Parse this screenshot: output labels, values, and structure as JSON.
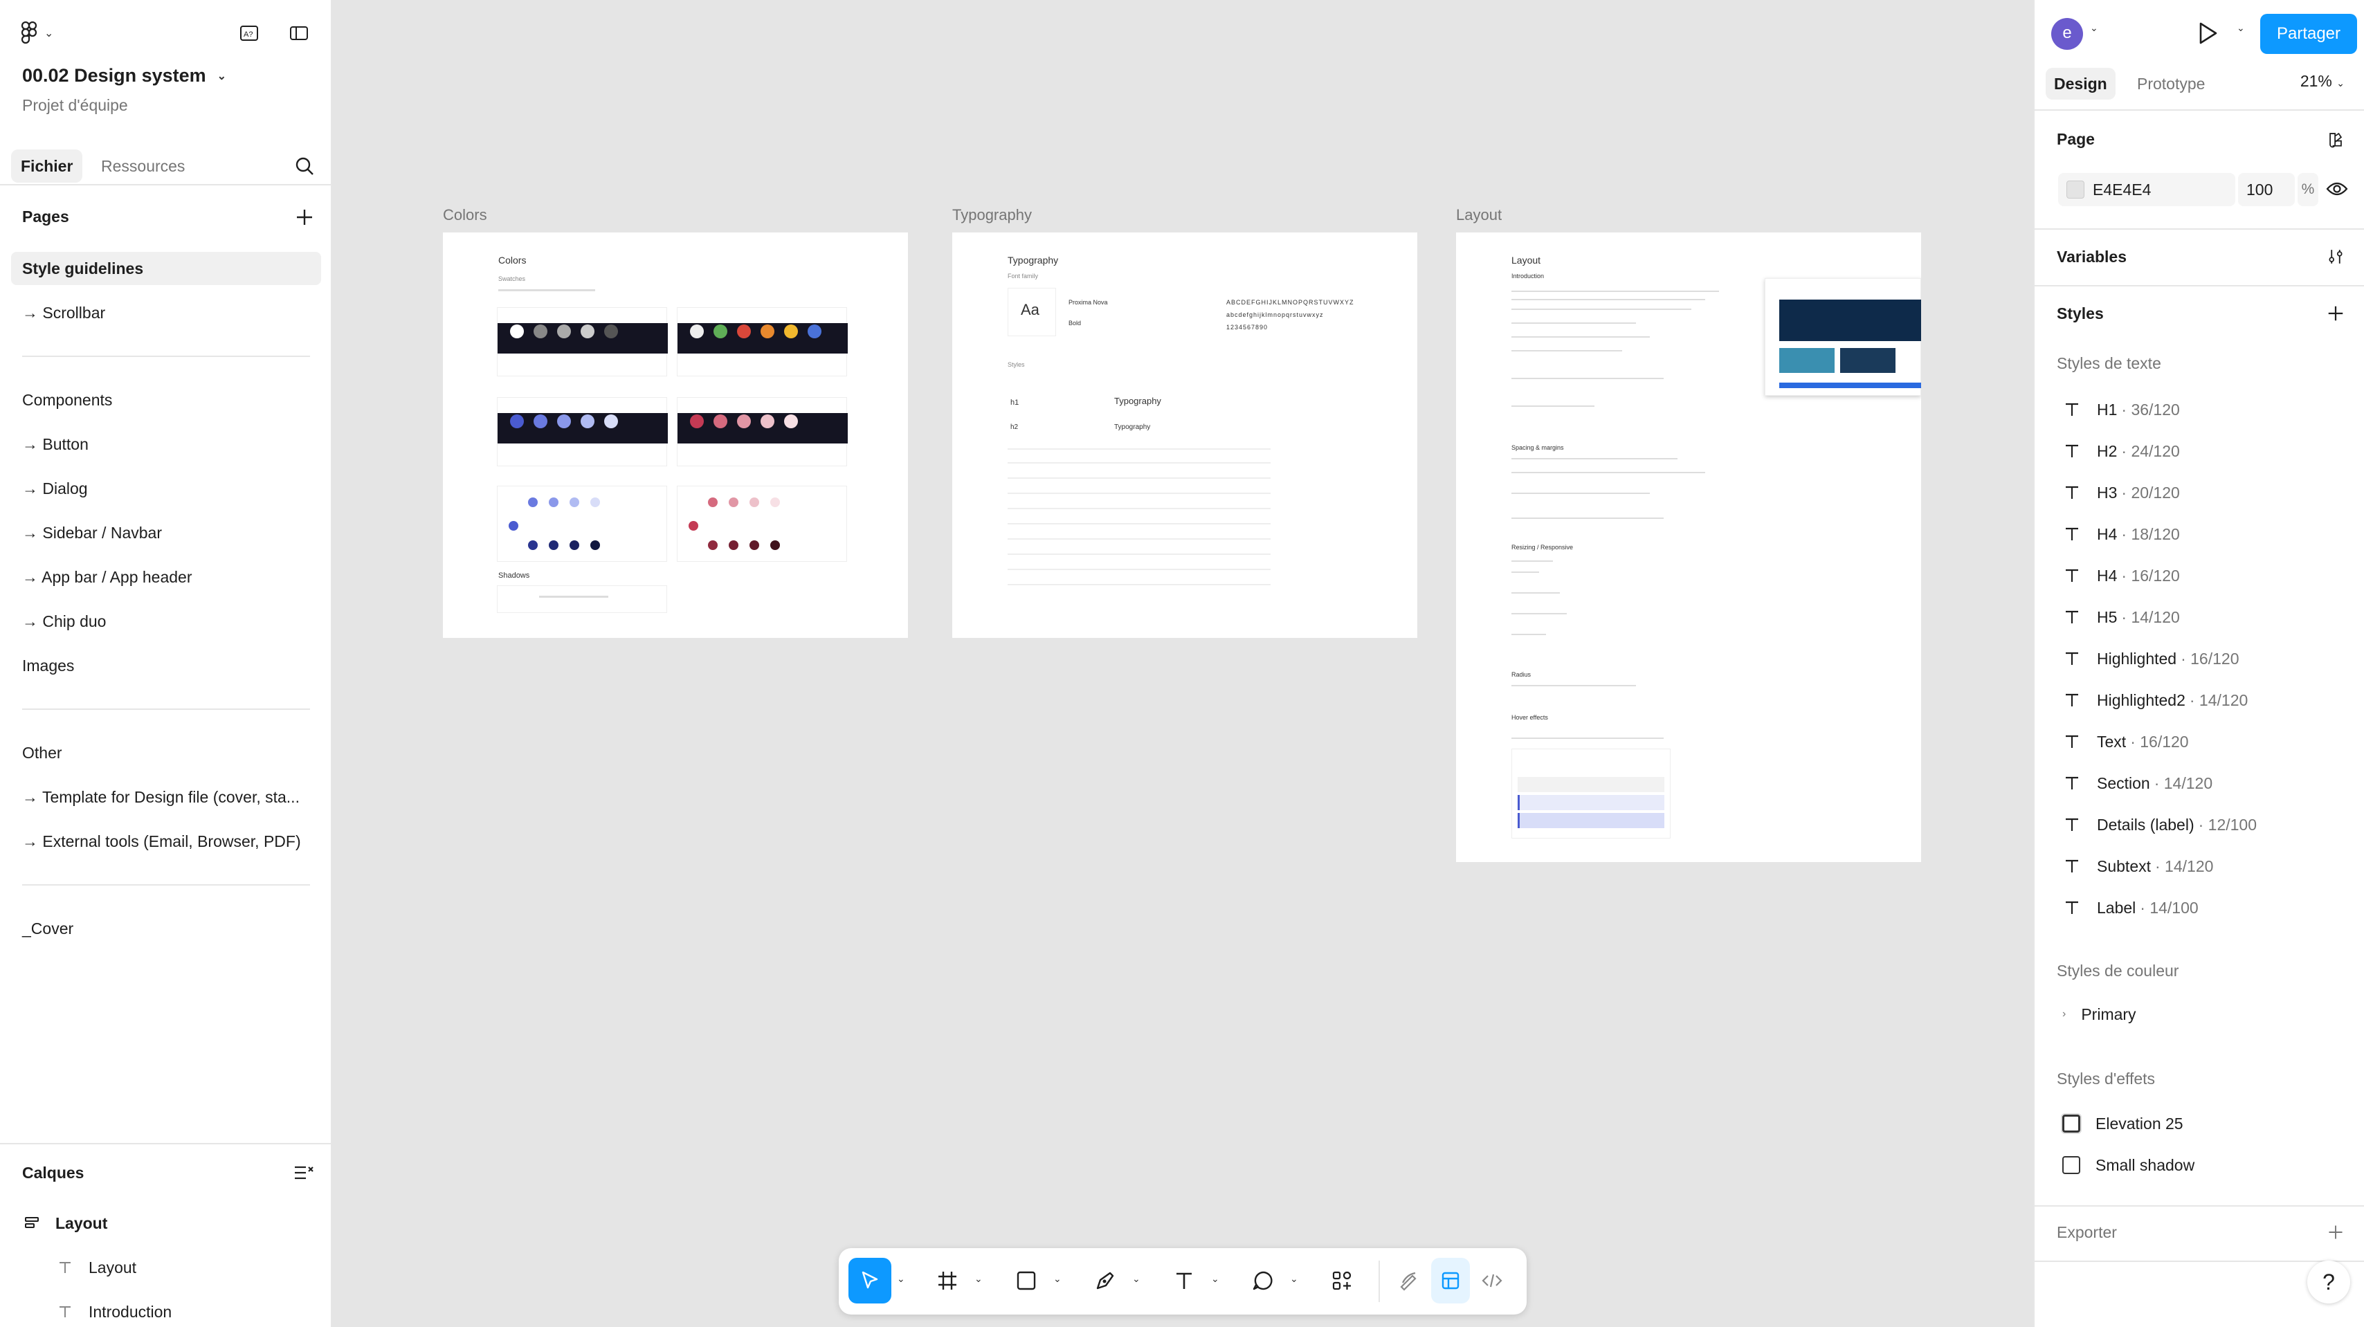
{
  "file": {
    "title": "00.02 Design system",
    "team": "Projet d'équipe"
  },
  "left_tabs": {
    "file": "Fichier",
    "assets": "Ressources"
  },
  "pages": {
    "heading": "Pages",
    "groups": [
      {
        "items": [
          "Style guidelines",
          "→ Scrollbar"
        ]
      },
      {
        "items": [
          "Components",
          "→ Button",
          "→ Dialog",
          "→ Sidebar / Navbar",
          "→ App bar / App header",
          "→ Chip duo",
          "Images"
        ]
      },
      {
        "items": [
          "Other",
          "→ Template for Design file (cover, sta...",
          "→ External tools (Email, Browser, PDF)"
        ]
      },
      {
        "items": [
          "_Cover"
        ]
      }
    ]
  },
  "layers": {
    "heading": "Calques",
    "items": [
      "Layout",
      "Layout",
      "Introduction"
    ]
  },
  "canvas": {
    "frames": [
      {
        "label": "Colors",
        "title": "Colors",
        "subtitle": "Swatches",
        "section2": "Shadows"
      },
      {
        "label": "Typography",
        "title": "Typography",
        "subtitle": "Font family",
        "aa": "Aa",
        "font_name": "Proxima Nova",
        "weight": "Bold",
        "alphabet_upper": "ABCDEFGHIJKLMNOPQRSTUVWXYZ",
        "alphabet_lower": "abcdefghijklmnopqrstuvwxyz",
        "digits": "1234567890",
        "styles_label": "Styles",
        "h1": "h1",
        "h2": "h2",
        "sample": "Typography"
      },
      {
        "label": "Layout",
        "title": "Layout",
        "subtitle": "Introduction",
        "sec_spacing": "Spacing & margins",
        "sec_resize": "Resizing / Responsive",
        "sec_radius": "Radius",
        "sec_hover": "Hover effects"
      }
    ]
  },
  "right": {
    "avatar_letter": "e",
    "share": "Partager",
    "tabs": {
      "design": "Design",
      "prototype": "Prototype"
    },
    "zoom": "21%",
    "page": {
      "title": "Page",
      "color": "E4E4E4",
      "opacity": "100",
      "unit": "%"
    },
    "variables": "Variables",
    "styles": {
      "title": "Styles",
      "text_heading": "Styles de texte",
      "text_styles": [
        {
          "name": "H1",
          "meta": "· 36/120"
        },
        {
          "name": "H2",
          "meta": "· 24/120"
        },
        {
          "name": "H3",
          "meta": "· 20/120"
        },
        {
          "name": "H4",
          "meta": "· 18/120"
        },
        {
          "name": "H4",
          "meta": "· 16/120"
        },
        {
          "name": "H5",
          "meta": "· 14/120"
        },
        {
          "name": "Highlighted",
          "meta": "· 16/120"
        },
        {
          "name": "Highlighted2",
          "meta": "· 14/120"
        },
        {
          "name": "Text",
          "meta": "· 16/120"
        },
        {
          "name": "Section",
          "meta": "· 14/120"
        },
        {
          "name": "Details (label)",
          "meta": "· 12/100"
        },
        {
          "name": "Subtext",
          "meta": "· 14/120"
        },
        {
          "name": "Label",
          "meta": "· 14/100"
        }
      ],
      "color_heading": "Styles de couleur",
      "color_styles": [
        "Primary"
      ],
      "effect_heading": "Styles d'effets",
      "effect_styles": [
        "Elevation 25",
        "Small shadow"
      ]
    },
    "export": "Exporter",
    "help": "?"
  },
  "colors": {
    "accent": "#0d99ff",
    "avatar": "#6a5acd",
    "canvas_bg": "#e5e5e5"
  }
}
